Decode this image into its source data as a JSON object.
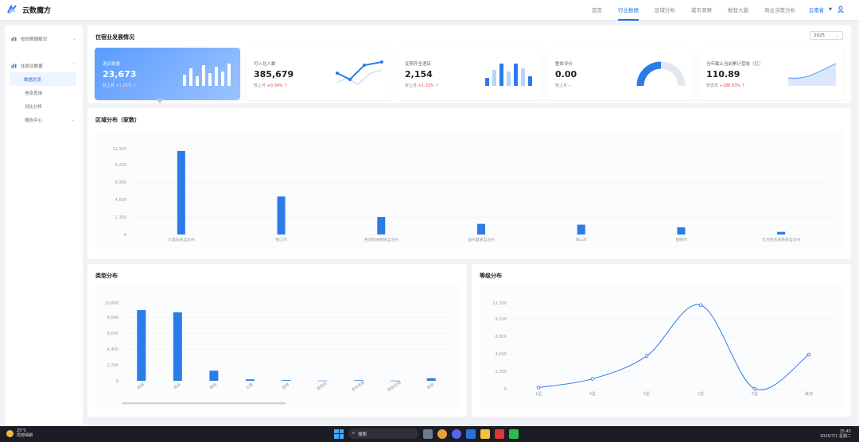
{
  "app": {
    "title": "云数魔方"
  },
  "nav": {
    "items": [
      "首页",
      "行业数据",
      "区域分析",
      "城市洞察",
      "数智大脑",
      "商业决策分析"
    ],
    "active_index": 1
  },
  "user": {
    "name": "云南省"
  },
  "sidebar": {
    "groups": [
      {
        "label": "省份数据概况",
        "expanded": false,
        "children": []
      },
      {
        "label": "住宿业数据",
        "expanded": true,
        "children": [
          {
            "label": "数据总览",
            "active": true
          },
          {
            "label": "信息查询",
            "active": false
          },
          {
            "label": "对比分析",
            "active": false
          },
          {
            "label": "报告中心",
            "active": false,
            "has_chevron": true
          }
        ]
      }
    ]
  },
  "overview": {
    "title": "住宿业发展情况",
    "year": "2025",
    "kpis": [
      {
        "label": "酒店数量",
        "value": "23,673",
        "sub_prefix": "较上月",
        "sub_change": "+1.05%",
        "active": true,
        "icon": "bar-chart-icon"
      },
      {
        "label": "可入住人数",
        "value": "385,679",
        "sub_prefix": "较上月",
        "sub_change": "+0.34%",
        "active": false,
        "icon": "line-chart-icon"
      },
      {
        "label": "证照齐全酒店",
        "value": "2,154",
        "sub_prefix": "较上月",
        "sub_change": "+1.32%",
        "active": false,
        "icon": "bar-chart-icon"
      },
      {
        "label": "整体评价",
        "value": "0.00",
        "sub_prefix": "较上月",
        "sub_change": "--",
        "active": false,
        "icon": "gauge-icon"
      },
      {
        "label": "当年截止当前累计营收（亿）",
        "value": "110.89",
        "sub_prefix": "较去年",
        "sub_change": "+186.03%",
        "active": false,
        "icon": "area-chart-icon"
      }
    ]
  },
  "region_chart": {
    "panel_title": "区域分布（家数）",
    "chart_data": {
      "type": "bar",
      "title": "",
      "categories": [
        "大理白族自治州",
        "丽江市",
        "西双版纳傣族自治州",
        "迪庆藏族自治州",
        "保山市",
        "昆明市",
        "红河哈尼族彝族自治州"
      ],
      "values": [
        11000,
        5000,
        2300,
        1400,
        1300,
        950,
        350
      ],
      "ylim": [
        0,
        11300
      ],
      "yticks": [
        "0",
        "2,300",
        "4,600",
        "6,900",
        "9,200",
        "11,300"
      ],
      "ytick_values": [
        0,
        2300,
        4600,
        6900,
        9200,
        11300
      ],
      "color": "#2b7be8"
    }
  },
  "type_chart": {
    "panel_title": "类型分布",
    "chart_data": {
      "type": "bar",
      "title": "",
      "categories": [
        "民宿",
        "酒店",
        "客栈",
        "公寓",
        "旅馆",
        "度假村",
        "青年旅舍",
        "特色住宿",
        "其他"
      ],
      "values": [
        9800,
        9500,
        1400,
        200,
        100,
        30,
        80,
        20,
        350
      ],
      "ylim": [
        0,
        10800
      ],
      "yticks": [
        "0",
        "2,200",
        "4,400",
        "6,600",
        "8,800",
        "10,800"
      ],
      "ytick_values": [
        0,
        2200,
        4400,
        6600,
        8800,
        10800
      ],
      "color": "#2b7be8"
    }
  },
  "grade_chart": {
    "panel_title": "等级分布",
    "chart_data": {
      "type": "line",
      "title": "",
      "categories": [
        "1星",
        "4星",
        "3星",
        "2星",
        "5星",
        "其他"
      ],
      "values": [
        150,
        1300,
        4300,
        11000,
        0,
        4500
      ],
      "ylim": [
        0,
        11300
      ],
      "yticks": [
        "0",
        "2,300",
        "4,600",
        "6,900",
        "9,200",
        "11,300"
      ],
      "ytick_values": [
        0,
        2300,
        4600,
        6900,
        9200,
        11300
      ],
      "color": "#2b7be8"
    }
  },
  "taskbar": {
    "weather_temp": "25°C",
    "weather_desc": "局部晴朗",
    "search_placeholder": "搜索",
    "time": "15:45",
    "date": "2025/7/1 星期二"
  }
}
